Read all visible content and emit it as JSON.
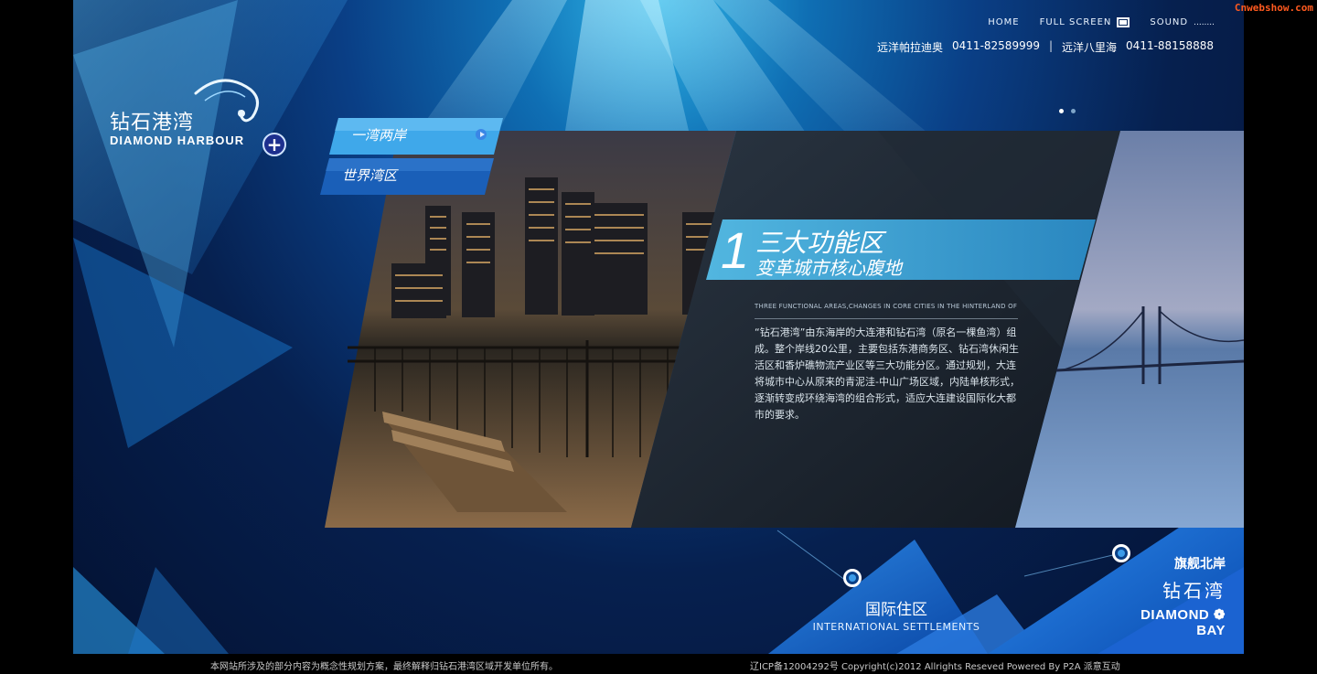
{
  "watermark": "Cnwebshow.com",
  "nav": {
    "home": "HOME",
    "fullscreen": "FULL SCREEN",
    "sound": "SOUND",
    "sound_dots": "........"
  },
  "phones": {
    "line1_name": "远洋帕拉迪奥",
    "line1_number": "0411-82589999",
    "separator": "|",
    "line2_name": "远洋八里海",
    "line2_number": "0411-88158888"
  },
  "logo": {
    "cn": "钻石港湾",
    "en": "DIAMOND HARBOUR"
  },
  "plus_symbol": "+",
  "menu": {
    "item1": "一湾两岸",
    "item2": "世界湾区"
  },
  "pager": {
    "count": 2,
    "active": 0
  },
  "feature": {
    "number": "1",
    "title": "三大功能区",
    "subtitle": "变革城市核心腹地",
    "english": "THREE FUNCTIONAL AREAS,CHANGES IN CORE CITIES IN THE HINTERLAND OF",
    "body": "“钻石港湾”由东海岸的大连港和钻石湾（原名一棵鱼湾）组成。整个岸线20公里，主要包括东港商务区、钻石湾休闲生活区和香炉礁物流产业区等三大功能分区。通过规划，大连将城市中心从原来的青泥洼-中山广场区域，内陆单核形式，逐渐转变成环绕海湾的组合形式，适应大连建设国际化大都市的要求。"
  },
  "intl": {
    "cn": "国际住区",
    "en": "INTERNATIONAL SETTLEMENTS"
  },
  "bay": {
    "cn1": "旗舰北岸",
    "cn2": "钻石湾",
    "en": "DIAMOND ❁ BAY"
  },
  "footer": {
    "left": "本网站所涉及的部分内容为概念性规划方案，最终解释归钻石港湾区域开发单位所有。",
    "right": "辽ICP备12004292号 Copyright(c)2012 Allrights Reseved Powered By P2A 派意互动"
  },
  "colors": {
    "accent": "#3aa9e0",
    "deep": "#06204f",
    "headline_band": "#49b6e6",
    "watermark": "#ff5a1f"
  }
}
